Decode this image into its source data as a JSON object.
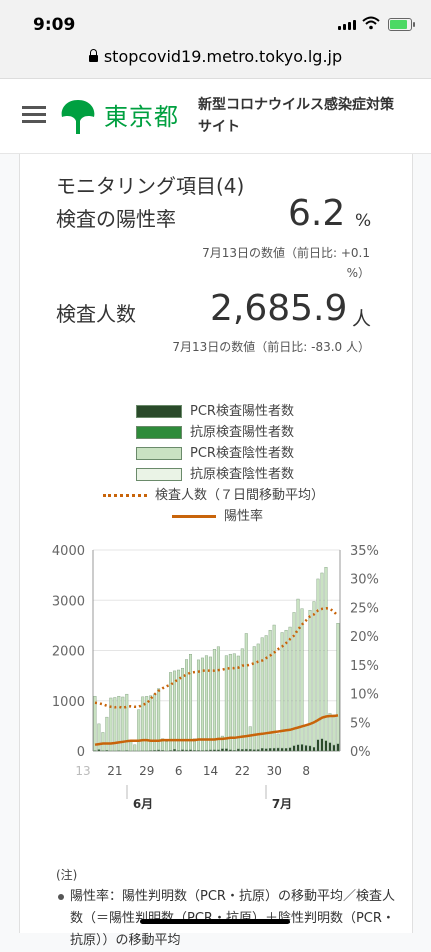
{
  "status_bar": {
    "time": "9:09"
  },
  "browser": {
    "url": "stopcovid19.metro.tokyo.lg.jp"
  },
  "header": {
    "logo_text": "東京都",
    "site_title": "新型コロナウイルス感染症対策サイト"
  },
  "card": {
    "title": "モニタリング項目(4)",
    "positivity": {
      "label": "検査の陽性率",
      "value": "6.2",
      "unit": "%",
      "note": "7月13日の数値（前日比: +0.1 %）"
    },
    "tests": {
      "label": "検査人数",
      "value": "2,685.9",
      "unit": "人",
      "note": "7月13日の数値（前日比: -83.0 人）"
    }
  },
  "legend": [
    {
      "label": "PCR検査陽性者数",
      "color": "#2a4a2a"
    },
    {
      "label": "抗原検査陽性者数",
      "color": "#2e8b3a"
    },
    {
      "label": "PCR検査陰性者数",
      "color": "#c9e2c2"
    },
    {
      "label": "抗原検査陰性者数",
      "color": "#eaf3e6"
    },
    {
      "label": "検査人数（７日間移動平均）",
      "color": "#c8640a"
    },
    {
      "label": "陽性率",
      "color": "#c8640a"
    }
  ],
  "chart_data": {
    "type": "bar",
    "x": [
      "5/13",
      "5/14",
      "5/15",
      "5/16",
      "5/17",
      "5/18",
      "5/19",
      "5/20",
      "5/21",
      "5/22",
      "5/23",
      "5/24",
      "5/25",
      "5/26",
      "5/27",
      "5/28",
      "5/29",
      "5/30",
      "5/31",
      "6/1",
      "6/2",
      "6/3",
      "6/4",
      "6/5",
      "6/6",
      "6/7",
      "6/8",
      "6/9",
      "6/10",
      "6/11",
      "6/12",
      "6/13",
      "6/14",
      "6/15",
      "6/16",
      "6/17",
      "6/18",
      "6/19",
      "6/20",
      "6/21",
      "6/22",
      "6/23",
      "6/24",
      "6/25",
      "6/26",
      "6/27",
      "6/28",
      "6/29",
      "6/30",
      "7/1",
      "7/2",
      "7/3",
      "7/4",
      "7/5",
      "7/6",
      "7/7",
      "7/8",
      "7/9",
      "7/10",
      "7/11",
      "7/12",
      "7/13"
    ],
    "series": [
      {
        "name": "PCR検査陽性者数",
        "values": [
          10,
          30,
          9,
          14,
          5,
          5,
          10,
          5,
          11,
          2,
          3,
          2,
          8,
          8,
          11,
          15,
          22,
          14,
          5,
          13,
          34,
          12,
          28,
          20,
          26,
          14,
          13,
          12,
          18,
          22,
          25,
          24,
          47,
          48,
          27,
          16,
          41,
          35,
          39,
          35,
          29,
          31,
          55,
          48,
          54,
          57,
          60,
          58,
          54,
          67,
          107,
          124,
          131,
          111,
          102,
          75,
          224,
          243,
          206,
          167,
          119,
          143
        ]
      },
      {
        "name": "抗原検査陽性者数",
        "values": [
          0,
          0,
          0,
          0,
          0,
          0,
          0,
          0,
          0,
          0,
          0,
          0,
          0,
          0,
          0,
          0,
          0,
          0,
          0,
          0,
          0,
          0,
          0,
          0,
          0,
          0,
          0,
          0,
          0,
          0,
          0,
          0,
          0,
          0,
          0,
          0,
          0,
          0,
          0,
          0,
          0,
          0,
          0,
          0,
          0,
          0,
          0,
          0,
          0,
          0,
          0,
          0,
          0,
          0,
          0,
          0,
          0,
          0,
          0,
          0,
          0,
          0
        ]
      },
      {
        "name": "PCR検査陰性者数",
        "values": [
          1080,
          510,
          360,
          660,
          1050,
          1060,
          1080,
          1070,
          1120,
          200,
          120,
          820,
          1070,
          1080,
          1090,
          1110,
          1220,
          230,
          180,
          1550,
          1560,
          1600,
          1620,
          1800,
          1900,
          230,
          1800,
          1840,
          1880,
          1850,
          2000,
          2050,
          250,
          1850,
          1900,
          1920,
          1850,
          2000,
          2300,
          450,
          2050,
          2100,
          2200,
          2250,
          2350,
          2450,
          280,
          2300,
          2350,
          2400,
          2650,
          2900,
          2700,
          400,
          2700,
          2900,
          3200,
          3300,
          3450,
          580,
          600,
          2400
        ]
      },
      {
        "name": "抗原検査陰性者数",
        "values": [
          0,
          0,
          0,
          0,
          0,
          0,
          0,
          0,
          0,
          0,
          0,
          0,
          0,
          0,
          0,
          0,
          0,
          0,
          0,
          0,
          0,
          0,
          0,
          0,
          0,
          0,
          0,
          0,
          0,
          0,
          0,
          0,
          0,
          0,
          0,
          0,
          0,
          0,
          0,
          0,
          0,
          0,
          0,
          0,
          0,
          0,
          0,
          0,
          0,
          0,
          0,
          0,
          0,
          0,
          0,
          0,
          0,
          0,
          0,
          0,
          0,
          0
        ]
      },
      {
        "name": "検査人数（７日間移動平均）",
        "values": [
          960,
          950,
          930,
          900,
          880,
          870,
          880,
          860,
          880,
          890,
          880,
          880,
          920,
          950,
          1040,
          1130,
          1200,
          1250,
          1290,
          1320,
          1380,
          1430,
          1480,
          1520,
          1560,
          1570,
          1580,
          1600,
          1600,
          1600,
          1600,
          1610,
          1620,
          1640,
          1650,
          1650,
          1660,
          1700,
          1700,
          1720,
          1750,
          1780,
          1800,
          1850,
          1900,
          1960,
          2030,
          2080,
          2150,
          2230,
          2300,
          2420,
          2520,
          2600,
          2680,
          2720,
          2800,
          2830,
          2840,
          2830,
          2770,
          2685.9
        ]
      },
      {
        "name": "陽性率",
        "values": [
          1.1,
          1.2,
          1.3,
          1.3,
          1.3,
          1.4,
          1.5,
          1.6,
          1.7,
          1.8,
          1.8,
          1.8,
          1.9,
          1.9,
          1.8,
          1.8,
          1.8,
          1.9,
          1.9,
          1.9,
          1.9,
          1.9,
          1.9,
          1.9,
          1.9,
          1.9,
          2.0,
          2.0,
          2.0,
          2.0,
          2.0,
          2.1,
          2.1,
          2.2,
          2.3,
          2.3,
          2.4,
          2.5,
          2.6,
          2.7,
          2.8,
          2.9,
          3.0,
          3.1,
          3.2,
          3.3,
          3.4,
          3.5,
          3.6,
          3.7,
          3.9,
          4.1,
          4.3,
          4.5,
          4.7,
          5.0,
          5.4,
          5.8,
          6.0,
          6.1,
          6.1,
          6.2
        ]
      }
    ],
    "x_ticks": [
      "13",
      "21",
      "29",
      "6",
      "14",
      "22",
      "30",
      "8"
    ],
    "month_labels": [
      "6月",
      "7月"
    ],
    "y_left": {
      "ticks": [
        "0",
        "1000",
        "2000",
        "3000",
        "4000"
      ],
      "ylim": [
        0,
        4000
      ]
    },
    "y_right": {
      "ticks": [
        "0%",
        "5%",
        "10%",
        "15%",
        "20%",
        "25%",
        "30%",
        "35%"
      ],
      "ylim": [
        0,
        35
      ]
    },
    "grid": true
  },
  "notes": {
    "title": "(注)",
    "text": "陽性率：陽性判明数（PCR・抗原）の移動平均／検査人数（＝陽性判明数（PCR・抗原）＋陰性判明数（PCR・抗原））の移動平均"
  }
}
